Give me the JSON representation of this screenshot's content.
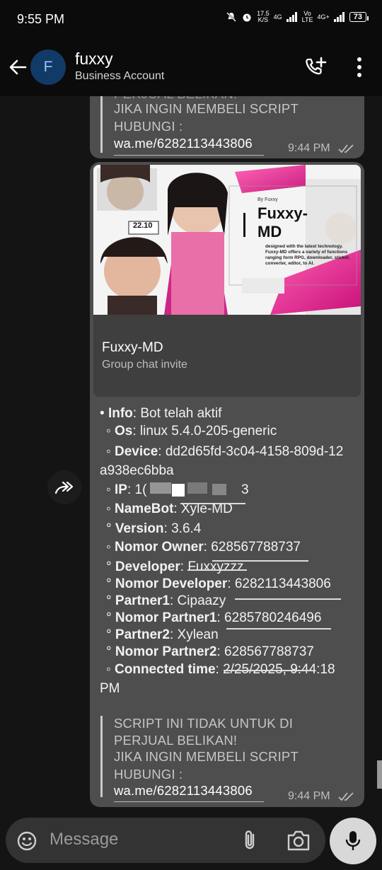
{
  "status_bar": {
    "time": "9:55 PM",
    "net_speed_value": "17.5",
    "net_speed_unit": "K/S",
    "sim1_label": "4G",
    "volte_top": "Vo",
    "volte_bottom": "LTE",
    "sim2_label": "4G+",
    "battery": "73"
  },
  "header": {
    "avatar_letter": "F",
    "title": "fuxxy",
    "subtitle": "Business Account"
  },
  "top_bubble": {
    "lines": [
      "PERJUAL BELIKAN!",
      "JIKA INGIN MEMBELI SCRIPT",
      "HUBUNGI :",
      "wa.me/6282113443806"
    ],
    "time": "9:44 PM"
  },
  "invite": {
    "banner_date": "22.10",
    "banner_by": "By Fuxxy",
    "banner_title_1": "Fuxxy-",
    "banner_title_2": "MD",
    "banner_desc": [
      "designed with the latest technology.",
      "Fuxxy-MD offers a variety of functions",
      "ranging form RPG, downloader, sticker,",
      "converter, editor, to AI."
    ],
    "title": "Fuxxy-MD",
    "subtitle": "Group chat invite"
  },
  "info": {
    "info_label": "Info",
    "info_value": ": Bot telah aktif",
    "os_label": "Os",
    "os_value": ": linux 5.4.0-205-generic",
    "device_label": "Device",
    "device_value": ": dd2d65fd-3c04-4158-809d-12",
    "device_value_2": "a938ec6bba",
    "ip_label": "IP",
    "ip_value": ": 1(",
    "ip_end": "3",
    "namebot_label": "NameBot",
    "namebot_value": ": Xyle-MD",
    "version_label": "Version",
    "version_value": ": 3.6.4",
    "owner_label": "Nomor Owner",
    "owner_value": ": 628567788737",
    "developer_label": "Developer",
    "developer_value": ": Fuxxyzzz",
    "dev_number_label": "Nomor Developer",
    "dev_number_value": ": 6282113443806",
    "partner1_label": "Partner1",
    "partner1_value": ": Cipaazy",
    "partner1_number_label": "Nomor Partner1",
    "partner1_number_value": ": 6285780246496",
    "partner2_label": "Partner2",
    "partner2_value": ": Xylean",
    "partner2_number_label": "Nomor Partner2",
    "partner2_number_value": ": 628567788737",
    "connected_label": "Connected time",
    "connected_value": ": 2/25/2025, 9:44:18",
    "connected_value_2": "PM"
  },
  "main_quote": {
    "lines": [
      "SCRIPT INI TIDAK UNTUK DI",
      "PERJUAL BELIKAN!",
      "JIKA INGIN MEMBELI SCRIPT",
      "HUBUNGI :",
      "wa.me/6282113443806"
    ],
    "time": "9:44 PM"
  },
  "composer": {
    "placeholder": "Message"
  }
}
